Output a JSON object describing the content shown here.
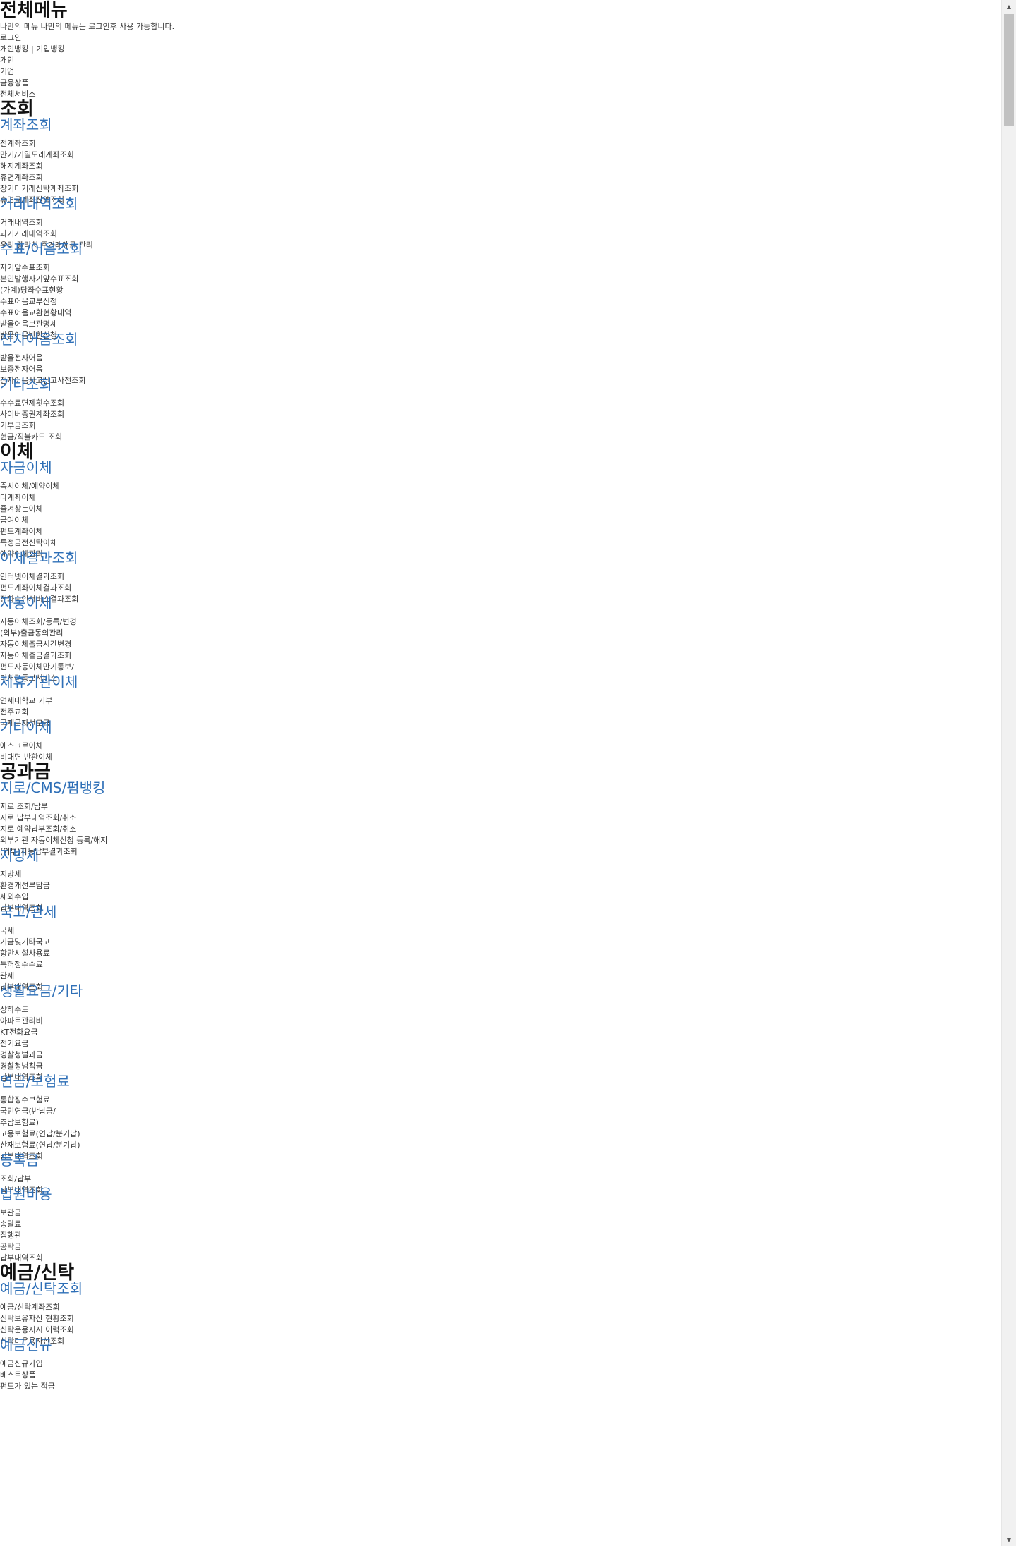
{
  "header": {
    "title": "전체메뉴",
    "notice": "나만의 메뉴 나만의 메뉴는 로그인후 사용 가능합니다.",
    "login": "로그인",
    "banking_switch": "개인뱅킹 | 기업뱅킹",
    "personal": "개인",
    "business": "기업",
    "products": "금융상품",
    "all_services": "전체서비스"
  },
  "sections": [
    {
      "title": "조회",
      "groups": [
        {
          "title": "계좌조회",
          "items": [
            "전계좌조회",
            "만기/기일도래계좌조회",
            "해지계좌조회",
            "휴면계좌조회",
            "장기미거래신탁계좌조회",
            "휴면금계좌잔액조회"
          ]
        },
        {
          "title": "거래내역조회",
          "items": [
            "거래내역조회",
            "과거거래내역조회",
            "우리 렐리치 주거래예금 관리"
          ]
        },
        {
          "title": "수표/어음조회",
          "items": [
            "자기앞수표조회",
            "본인발행자기앞수표조회",
            "(가계)당좌수표현황",
            "수표어음교부신청",
            "수표어음교환현황내역",
            "받을어음보관명세",
            "받을어음반환신청"
          ]
        },
        {
          "title": "전자어음조회",
          "items": [
            "받을전자어음",
            "보증전자어음",
            "전자어음사고신고사전조회"
          ]
        },
        {
          "title": "기타조회",
          "items": [
            "수수료면제횟수조회",
            "사이버증권계좌조회",
            "기부금조회",
            "현금/직불카드 조회"
          ]
        }
      ]
    },
    {
      "title": "이체",
      "groups": [
        {
          "title": "자금이체",
          "items": [
            "즉시이체/예약이체",
            "다계좌이체",
            "즐겨찾는이체",
            "급여이체",
            "펀드계좌이체",
            "특정금전신탁이체",
            "예약이체관리"
          ]
        },
        {
          "title": "이체결과조회",
          "items": [
            "인터넷이체결과조회",
            "펀드계좌이체결과조회",
            "전화승인서비스결과조회"
          ]
        },
        {
          "title": "자동이체",
          "items": [
            "자동이체조회/등록/변경",
            "(외부)출금동의관리",
            "자동이체출금시간변경",
            "자동이체출금결과조회",
            "펀드자동이체만기통보/",
            "미처리통보서비스"
          ]
        },
        {
          "title": "제휴기관이체",
          "items": [
            "연세대학교 기부",
            "전주교회",
            "국제문자선모금"
          ]
        },
        {
          "title": "기타이체",
          "items": [
            "에스크로이체",
            "비대면 반환이체"
          ]
        }
      ]
    },
    {
      "title": "공과금",
      "groups": [
        {
          "title": "지로/CMS/펌뱅킹",
          "items": [
            "지로 조회/납부",
            "지로 납부내역조회/취소",
            "지로 예약납부조회/취소",
            "외부기관 자동이체신청 등록/해지",
            "(외부)자동납부결과조회"
          ]
        },
        {
          "title": "지방세",
          "items": [
            "지방세",
            "환경개선부담금",
            "세외수입",
            "납부내역조회"
          ]
        },
        {
          "title": "국고/관세",
          "items": [
            "국세",
            "기금및기타국고",
            "항만시설사용료",
            "특허청수수료",
            "관세",
            "납부내역조회"
          ]
        },
        {
          "title": "생활요금/기타",
          "items": [
            "상하수도",
            "아파트관리비",
            "KT전화요금",
            "전기요금",
            "경찰청벌과금",
            "경찰청범칙금",
            "납부내역조회"
          ]
        },
        {
          "title": "연금/보험료",
          "items": [
            "통합징수보험료",
            "국민연금(반납금/",
            "추납보험료)",
            "고용보험료(연납/분기납)",
            "산재보험료(연납/분기납)",
            "납부내역조회"
          ]
        },
        {
          "title": "등록금",
          "items": [
            "조회/납부",
            "납부내역조회"
          ]
        },
        {
          "title": "법원비용",
          "items": [
            "보관금",
            "송달료",
            "집행관",
            "공탁금",
            "납부내역조회"
          ]
        }
      ]
    },
    {
      "title": "예금/신탁",
      "groups": [
        {
          "title": "예금/신탁조회",
          "items": [
            "예금/신탁계좌조회",
            "신탁보유자산 현황조회",
            "신탁운용지시 이력조회",
            "신탁미운용자산조회"
          ]
        },
        {
          "title": "예금신규",
          "items": [
            "예금신규가입",
            "베스트상품",
            "펀드가 있는 적금"
          ]
        }
      ]
    }
  ],
  "scrollbar": {
    "up_icon": "▲",
    "down_icon": "▼"
  }
}
